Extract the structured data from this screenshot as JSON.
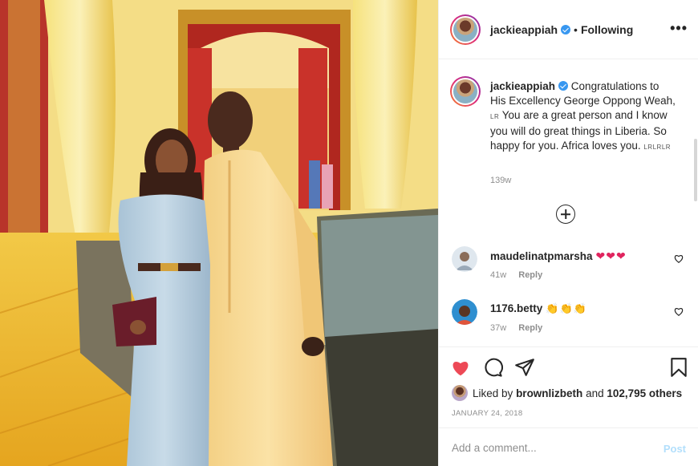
{
  "post": {
    "username": "jackieappiah",
    "follow_state": "Following",
    "more_label": "•••"
  },
  "caption": {
    "username": "jackieappiah",
    "text_part1": " Congratulations to His Excellency George Oppong Weah, ",
    "small1": "LR",
    "text_part2": " You are a great person and I know you will do great things in Liberia. So happy for you. Africa loves you. ",
    "small2": "LRLRLR",
    "time": "139w"
  },
  "comments": [
    {
      "username": "maudelinatpmarsha",
      "emoji": "❤❤❤",
      "time": "41w",
      "reply_label": "Reply"
    },
    {
      "username": "1176.betty",
      "emoji": "👏👏👏",
      "time": "37w",
      "reply_label": "Reply"
    }
  ],
  "likes": {
    "prefix": "Liked by ",
    "user": "brownlizbeth",
    "middle": " and ",
    "others": "102,795 others"
  },
  "date": "JANUARY 24, 2018",
  "add_comment": {
    "placeholder": "Add a comment...",
    "post_label": "Post"
  },
  "colors": {
    "heart": "#ed4956",
    "verified": "#3897f0",
    "post_disabled": "#b2dffc"
  }
}
